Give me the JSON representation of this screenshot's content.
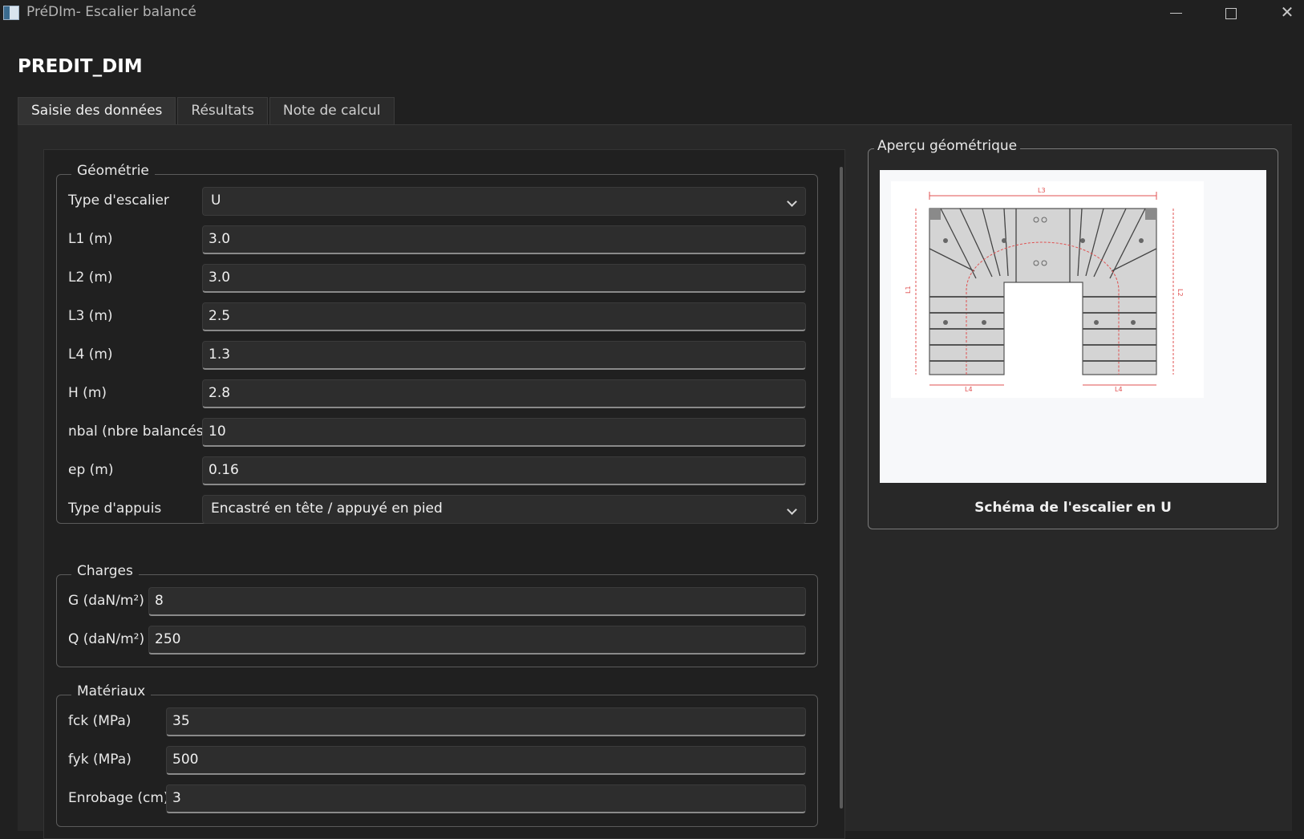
{
  "window": {
    "title": "PréDIm- Escalier balancé"
  },
  "app_title": "PREDIT_DIM",
  "tabs": [
    {
      "label": "Saisie des données",
      "active": true
    },
    {
      "label": "Résultats",
      "active": false
    },
    {
      "label": "Note de calcul",
      "active": false
    }
  ],
  "geometrie": {
    "title": "Géométrie",
    "type_escalier": {
      "label": "Type d'escalier",
      "value": "U"
    },
    "l1": {
      "label": "L1 (m)",
      "value": "3.0"
    },
    "l2": {
      "label": "L2 (m)",
      "value": "3.0"
    },
    "l3": {
      "label": "L3 (m)",
      "value": "2.5"
    },
    "l4": {
      "label": "L4 (m)",
      "value": "1.3"
    },
    "h": {
      "label": "H (m)",
      "value": "2.8"
    },
    "nbal": {
      "label": "nbal (nbre balancés)",
      "value": "10"
    },
    "ep": {
      "label": "ep (m)",
      "value": "0.16"
    },
    "type_appuis": {
      "label": "Type d'appuis",
      "value": "Encastré en tête / appuyé en pied"
    }
  },
  "charges": {
    "title": "Charges",
    "g": {
      "label": "G (daN/m²)",
      "value": "8"
    },
    "q": {
      "label": "Q (daN/m²)",
      "value": "250"
    }
  },
  "materiaux": {
    "title": "Matériaux",
    "fck": {
      "label": "fck (MPa)",
      "value": "35"
    },
    "fyk": {
      "label": "fyk (MPa)",
      "value": "500"
    },
    "enrobage": {
      "label": "Enrobage (cm)",
      "value": "3"
    }
  },
  "apercu": {
    "title": "Aperçu géométrique",
    "caption": "Schéma de l'escalier en U",
    "dim_labels": {
      "top": "L3",
      "left": "L1",
      "right": "L2",
      "bottom_left": "L4",
      "bottom_right": "L4"
    }
  },
  "colors": {
    "background": "#202020",
    "field_bg": "#2d2d2d",
    "dim_line": "#e05050"
  }
}
